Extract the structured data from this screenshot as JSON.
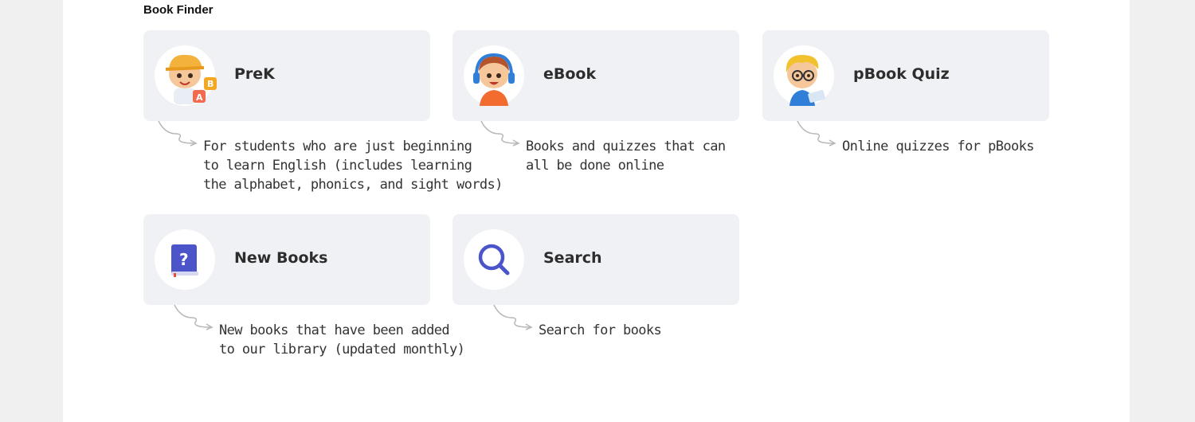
{
  "section": {
    "title": "Book Finder"
  },
  "cards": [
    {
      "label": "PreK",
      "icon": "child-abc-blocks-icon",
      "description": "For students who are just beginning\nto learn English (includes learning\nthe alphabet, phonics, and sight words)"
    },
    {
      "label": "eBook",
      "icon": "child-headphones-icon",
      "description": "Books and quizzes that can\nall be done online"
    },
    {
      "label": "pBook Quiz",
      "icon": "child-glasses-reading-icon",
      "description": "Online quizzes for pBooks"
    },
    {
      "label": "New Books",
      "icon": "question-book-icon",
      "description": "New books that have been added\nto our library (updated monthly)"
    },
    {
      "label": "Search",
      "icon": "magnifier-icon",
      "description": "Search for books"
    }
  ],
  "colors": {
    "card_bg": "#f0f1f4",
    "accent_blue": "#4b55c9",
    "text": "#2d2d2d"
  }
}
